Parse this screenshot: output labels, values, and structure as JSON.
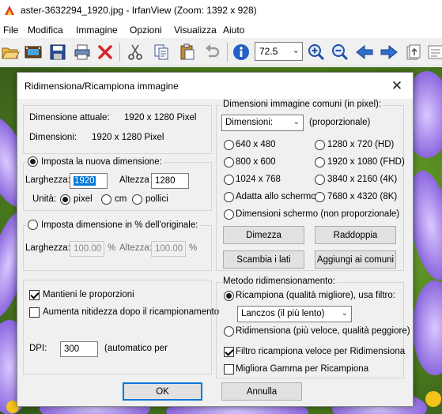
{
  "window": {
    "title": "aster-3632294_1920.jpg - IrfanView (Zoom: 1392 x 928)"
  },
  "menu": [
    "File",
    "Modifica",
    "Immagine",
    "Opzioni",
    "Visualizza",
    "Aiuto"
  ],
  "toolbar": {
    "icons": [
      "open-folder-icon",
      "slideshow-icon",
      "save-icon",
      "print-icon",
      "delete-icon",
      "cut-icon",
      "copy-icon",
      "paste-icon",
      "undo-icon",
      "info-icon",
      "zoom-combo",
      "zoom-in-icon",
      "zoom-out-icon",
      "previous-icon",
      "next-icon",
      "first-page-icon",
      "options-icon"
    ],
    "zoom_value": "72.5"
  },
  "dialog": {
    "title": "Ridimensiona/Ricampiona immagine",
    "current": {
      "label": "Dimensione attuale:",
      "value": "1920  x  1280  Pixel",
      "size_label": "Dimensioni:",
      "size_value": "1920  x  1280  Pixel"
    },
    "new_size": {
      "radio_label": "Imposta la nuova dimensione:",
      "width_label": "Larghezza:",
      "width_value": "1920",
      "height_label": "Altezza",
      "height_value": "1280",
      "units_label": "Unità:",
      "unit_pixel": "pixel",
      "unit_cm": "cm",
      "unit_inch": "pollici"
    },
    "percent": {
      "radio_label": "Imposta dimensione in % dell'originale:",
      "width_label": "Larghezza:",
      "width_value": "100.00",
      "pct1": "%",
      "height_label": "Altezza:",
      "height_value": "100.00",
      "pct2": "%"
    },
    "options": {
      "keep_ratio": "Mantieni le proporzioni",
      "sharpen": "Aumenta nitidezza dopo il ricampionamento",
      "dpi_label": "DPI:",
      "dpi_value": "300",
      "dpi_note": "(automatico per"
    },
    "common": {
      "group_label": "Dimensioni immagine comuni (in pixel):",
      "combo_value": "Dimensioni:",
      "proportional": "(proporzionale)",
      "sizes": [
        "640 x 480",
        "1280 x 720   (HD)",
        "800 x 600",
        "1920 x 1080 (FHD)",
        "1024 x 768",
        "3840 x 2160 (4K)",
        "Adatta allo schermo",
        "7680 x 4320 (8K)"
      ],
      "screen_nonprop": "Dimensioni schermo (non proporzionale)",
      "btn_half": "Dimezza",
      "btn_double": "Raddoppia",
      "btn_swap": "Scambia i lati",
      "btn_add": "Aggiungi ai comuni"
    },
    "method": {
      "group_label": "Metodo ridimensionamento:",
      "resample": "Ricampiona (qualità migliore), usa filtro:",
      "filter_value": "Lanczos (il più lento)",
      "resize": "Ridimensiona (più veloce, qualità peggiore)",
      "fast_filter": "Filtro ricampiona veloce per Ridimensiona",
      "gamma": "Migliora Gamma per Ricampiona"
    },
    "buttons": {
      "ok": "OK",
      "cancel": "Annulla"
    }
  }
}
